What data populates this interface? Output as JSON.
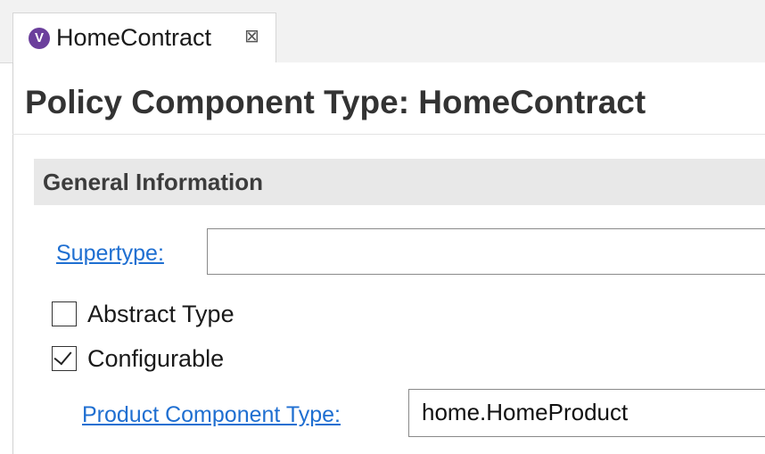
{
  "tab": {
    "icon": "policy-component-type-icon",
    "icon_glyph": "V",
    "label": "HomeContract",
    "close_glyph": "⊠"
  },
  "form": {
    "title": "Policy Component Type: HomeContract"
  },
  "section": {
    "title": "General Information"
  },
  "fields": {
    "supertype_label": "Supertype:",
    "supertype_value": "",
    "abstract_label": "Abstract Type",
    "abstract_checked": false,
    "configurable_label": "Configurable",
    "configurable_checked": true,
    "product_component_label": "Product Component Type:",
    "product_component_value": "home.HomeProduct"
  },
  "colors": {
    "link": "#1f6fd1",
    "icon_bg": "#6b3f9c",
    "section_bg": "#e8e8e8"
  }
}
